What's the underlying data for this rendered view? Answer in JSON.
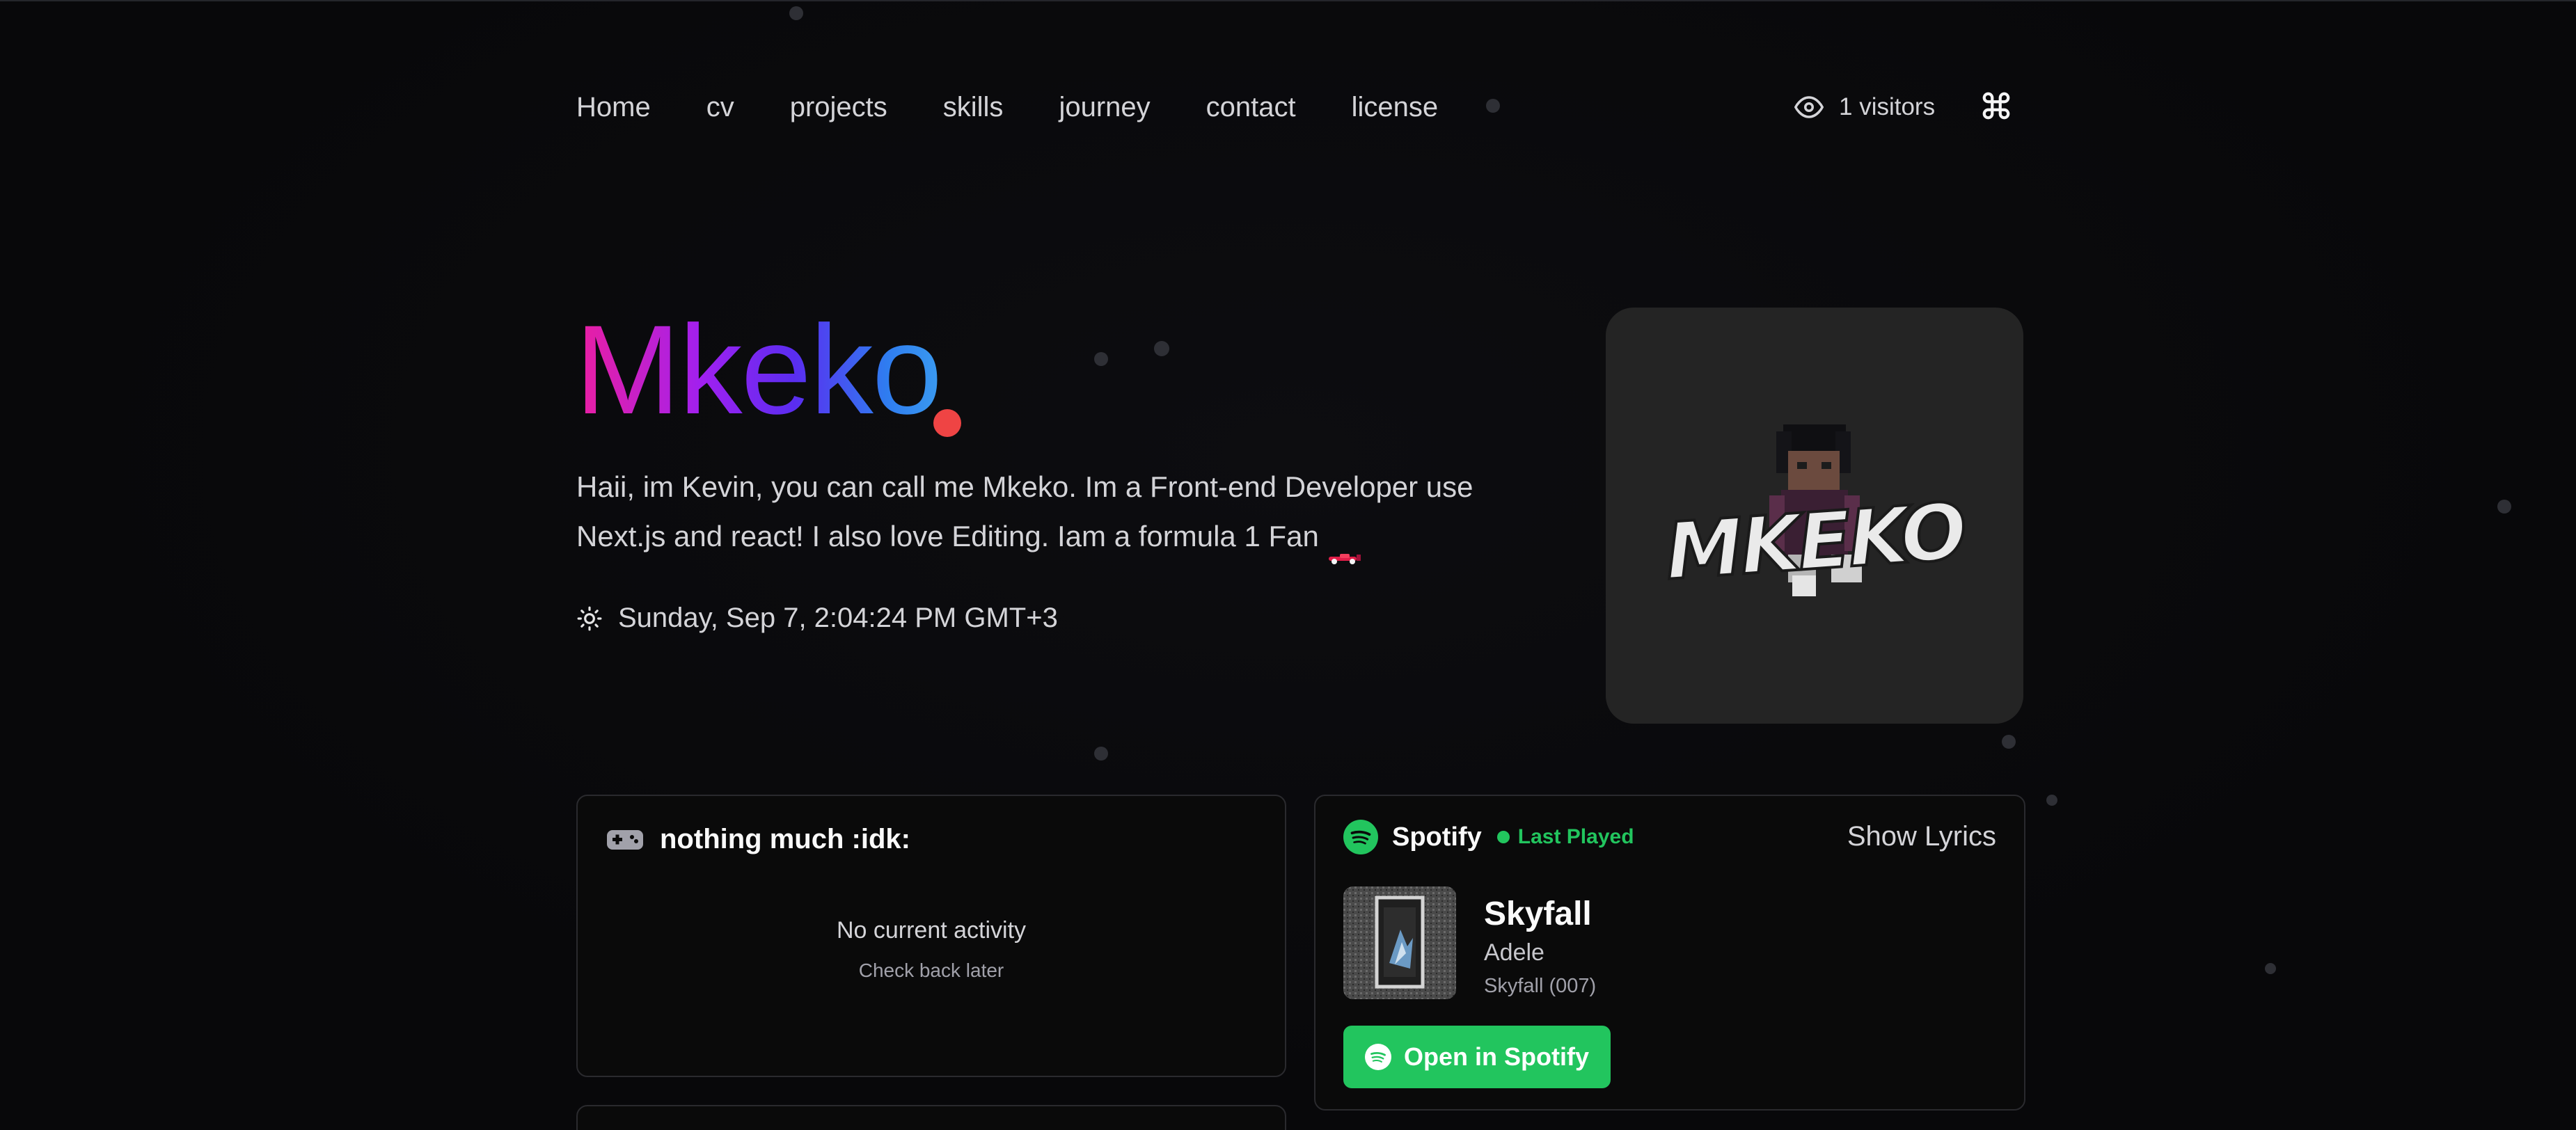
{
  "nav": {
    "items": [
      {
        "label": "Home"
      },
      {
        "label": "cv"
      },
      {
        "label": "projects"
      },
      {
        "label": "skills"
      },
      {
        "label": "journey"
      },
      {
        "label": "contact"
      },
      {
        "label": "license"
      }
    ],
    "visitors_label": "1 visitors",
    "command_icon": "command-icon"
  },
  "hero": {
    "brand": "Mkeko",
    "bio": "Haii, im Kevin, you can call me Mkeko. Im a Front-end Developer use Next.js and react! I also love Editing. Iam a formula 1 Fan",
    "datetime": "Sunday, Sep 7, 2:04:24 PM GMT+3",
    "avatar_text": "MKEKO",
    "brand_dot_color": "#ef4444"
  },
  "activity": {
    "title": "nothing much :idk:",
    "empty_title": "No current activity",
    "empty_sub": "Check back later"
  },
  "spotify": {
    "name": "Spotify",
    "status": "Last Played",
    "lyrics_button": "Show Lyrics",
    "song": "Skyfall",
    "artist": "Adele",
    "album": "Skyfall (007)",
    "open_button": "Open in Spotify",
    "accent": "#22c55e"
  }
}
